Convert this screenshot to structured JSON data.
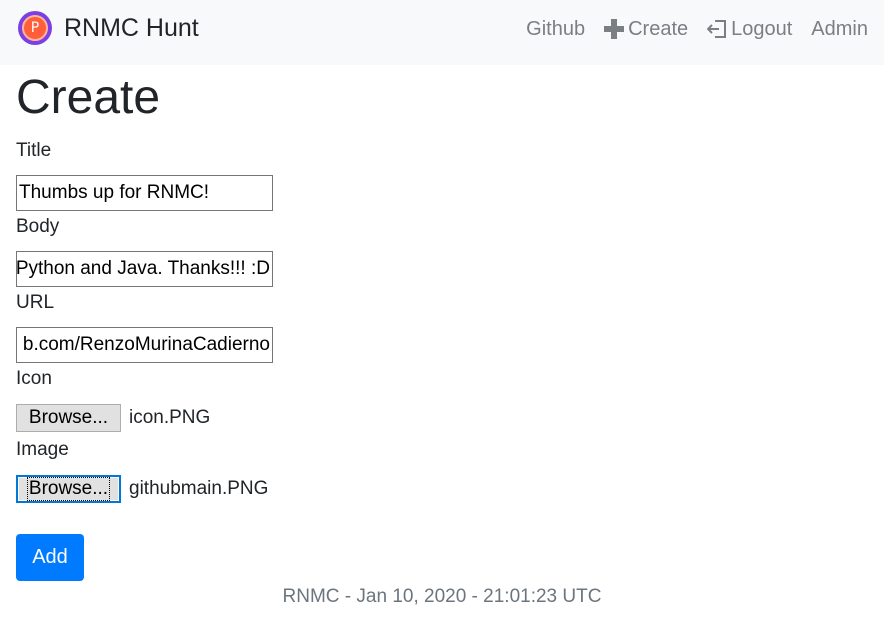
{
  "navbar": {
    "brand_letter": "P",
    "brand_name": "RNMC Hunt",
    "links": [
      {
        "label": "Github",
        "icon": ""
      },
      {
        "label": "Create",
        "icon": "plus-icon"
      },
      {
        "label": "Logout",
        "icon": "logout-icon"
      },
      {
        "label": "Admin",
        "icon": ""
      }
    ]
  },
  "page": {
    "title": "Create"
  },
  "form": {
    "title_label": "Title",
    "title_value": "Thumbs up for RNMC!",
    "body_label": "Body",
    "body_value": "Python and Java. Thanks!!! :D",
    "url_label": "URL",
    "url_value": "b.com/RenzoMurinaCadierno",
    "icon_label": "Icon",
    "icon_button": "Browse...",
    "icon_file": "icon.PNG",
    "image_label": "Image",
    "image_button": "Browse...",
    "image_file": "githubmain.PNG",
    "submit_label": "Add"
  },
  "footer": {
    "text": "RNMC - Jan 10, 2020 - 21:01:23 UTC"
  },
  "colors": {
    "primary": "#007bff",
    "navbar_bg": "#f8f9fa",
    "nav_link": "#7a7f84"
  }
}
